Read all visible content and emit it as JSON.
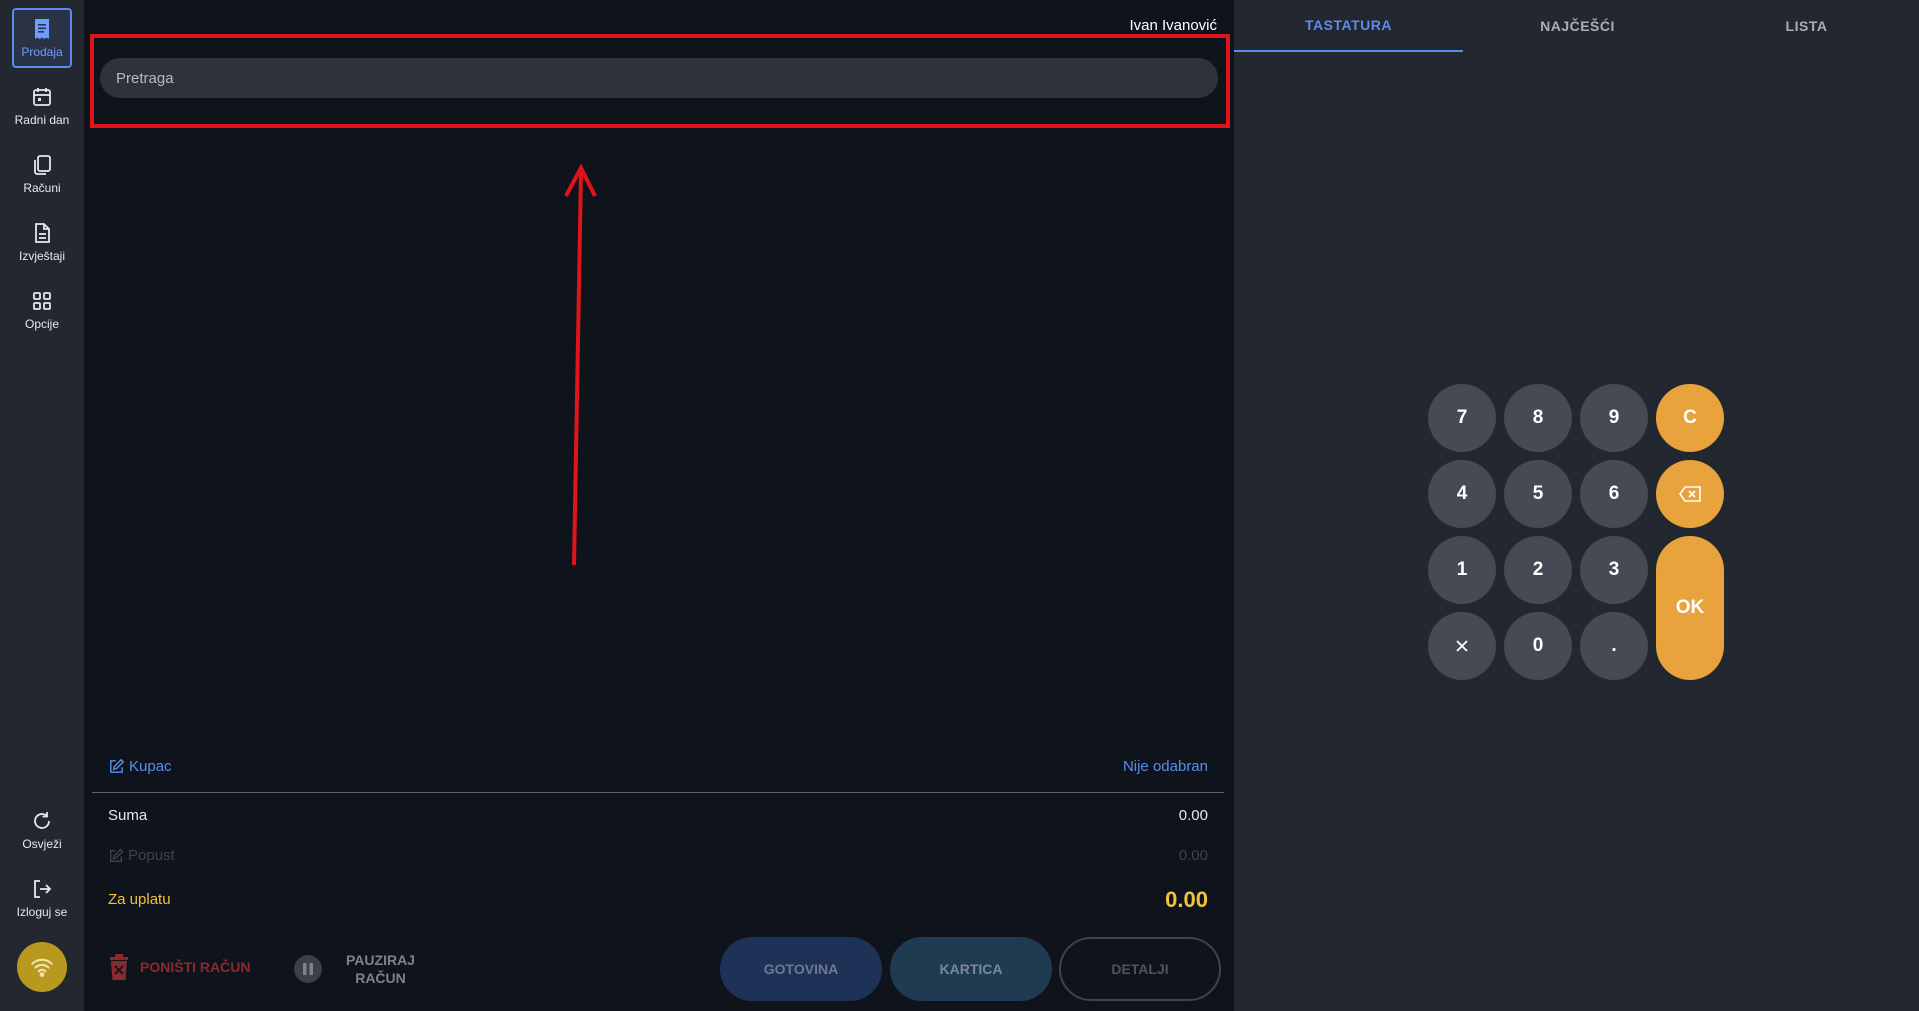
{
  "sidebar": {
    "items": [
      {
        "label": "Prodaja",
        "icon": "receipt-icon"
      },
      {
        "label": "Radni dan",
        "icon": "calendar-icon"
      },
      {
        "label": "Računi",
        "icon": "documents-icon"
      },
      {
        "label": "Izvještaji",
        "icon": "report-icon"
      },
      {
        "label": "Opcije",
        "icon": "grid-icon"
      }
    ],
    "bottom_items": [
      {
        "label": "Osvježi",
        "icon": "refresh-icon"
      },
      {
        "label": "Izloguj se",
        "icon": "logout-icon"
      }
    ],
    "wifi_icon": "wifi-icon"
  },
  "header": {
    "user_name": "Ivan Ivanović"
  },
  "search": {
    "placeholder": "Pretraga",
    "value": ""
  },
  "summary": {
    "customer_label": "Kupac",
    "customer_value": "Nije odabran",
    "sum_label": "Suma",
    "sum_value": "0.00",
    "discount_label": "Popust",
    "discount_value": "0.00",
    "total_label": "Za uplatu",
    "total_value": "0.00"
  },
  "actions": {
    "cancel_label": "PONIŠTI RAČUN",
    "pause_label_line1": "PAUZIRAJ",
    "pause_label_line2": "RAČUN",
    "cash_label": "GOTOVINA",
    "card_label": "KARTICA",
    "details_label": "DETALJI"
  },
  "tabs": [
    {
      "label": "TASTATURA",
      "active": true
    },
    {
      "label": "NAJČEŠĆI",
      "active": false
    },
    {
      "label": "LISTA",
      "active": false
    }
  ],
  "keypad": {
    "keys": [
      "7",
      "8",
      "9",
      "C",
      "4",
      "5",
      "6",
      "1",
      "2",
      "3",
      "0",
      "."
    ],
    "ok_label": "OK",
    "backspace_icon": "backspace-icon",
    "multiply_icon": "multiply-icon"
  },
  "colors": {
    "accent": "#5a8cf0",
    "highlight_box": "#e0141b",
    "orange": "#e8a33c",
    "total": "#f0c338"
  }
}
